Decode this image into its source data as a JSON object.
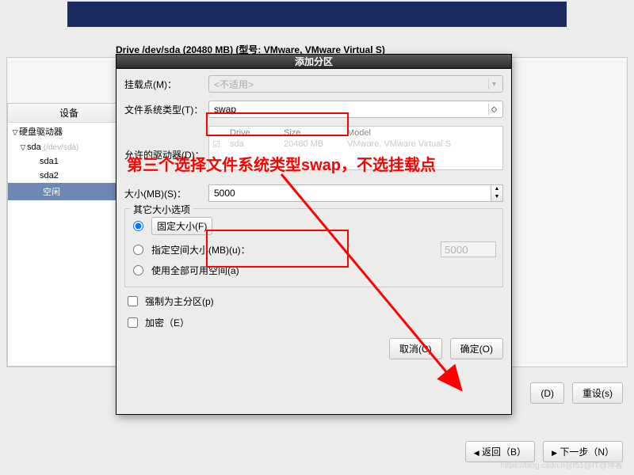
{
  "top": {
    "drive_title": "Drive /dev/sda (20480 MB) (型号: VMware, VMware Virtual S)"
  },
  "tree": {
    "header": "设备",
    "root_label": "硬盘驱动器",
    "sda_label": "sda",
    "sda_hint": "(/dev/sda)",
    "children": [
      "sda1",
      "sda2"
    ],
    "free_label": "空闲"
  },
  "dialog": {
    "title": "添加分区",
    "mount": {
      "label": "挂载点(M)：",
      "value": "<不适用>"
    },
    "fstype": {
      "label": "文件系统类型(T)：",
      "value": "swap"
    },
    "allowed_drives": {
      "label": "允许的驱动器(D)：",
      "cols": [
        "",
        "Drive",
        "Size",
        "Model"
      ],
      "row": {
        "checked": true,
        "drive": "sda",
        "size": "20480 MB",
        "model": "VMware, VMware Virtual S"
      }
    },
    "size": {
      "label": "大小(MB)(S)：",
      "value": "5000"
    },
    "options": {
      "legend": "其它大小选项",
      "fixed": "固定大小(F)",
      "upto": "指定空间大小(MB)(u)：",
      "upto_value": "5000",
      "fill": "使用全部可用空间(a)"
    },
    "force_primary": "强制为主分区(p)",
    "encrypt": "加密（E）",
    "cancel": "取消(C)",
    "ok": "确定(O)"
  },
  "bg_buttons": {
    "d": "(D)",
    "reset": "重设(s)",
    "back": "返回（B）",
    "next": "下一步（N）"
  },
  "annotations": {
    "instruction": "第三个选择文件系统类型swap，不选挂载点"
  },
  "watermark": "https://blog.csdn.n@f51@fT@博客"
}
